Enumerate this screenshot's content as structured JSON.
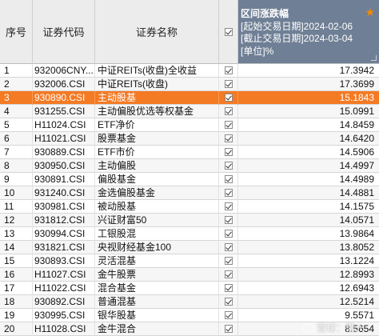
{
  "header": {
    "idx": "序号",
    "code": "证券代码",
    "name": "证券名称",
    "pct_title": "区间涨跌幅",
    "pct_start": "[起始交易日期]2024-02-06",
    "pct_end": "[截止交易日期]2024-03-04",
    "pct_unit": "[单位]%"
  },
  "rows": [
    {
      "idx": "1",
      "code": "932006CNY...",
      "name": "中证REITs(收盘)全收益",
      "pct": "17.3942"
    },
    {
      "idx": "2",
      "code": "932006.CSI",
      "name": "中证REITs(收盘)",
      "pct": "17.3699"
    },
    {
      "idx": "3",
      "code": "930890.CSI",
      "name": "主动股基",
      "pct": "15.1843"
    },
    {
      "idx": "4",
      "code": "931255.CSI",
      "name": "主动偏股优选等权基金",
      "pct": "15.0991"
    },
    {
      "idx": "5",
      "code": "H11024.CSI",
      "name": "ETF净价",
      "pct": "14.8459"
    },
    {
      "idx": "6",
      "code": "H11021.CSI",
      "name": "股票基金",
      "pct": "14.6420"
    },
    {
      "idx": "7",
      "code": "930889.CSI",
      "name": "ETF市价",
      "pct": "14.5906"
    },
    {
      "idx": "8",
      "code": "930950.CSI",
      "name": "主动偏股",
      "pct": "14.4997"
    },
    {
      "idx": "9",
      "code": "930891.CSI",
      "name": "偏股基金",
      "pct": "14.4989"
    },
    {
      "idx": "10",
      "code": "931240.CSI",
      "name": "金选偏股基金",
      "pct": "14.4881"
    },
    {
      "idx": "11",
      "code": "930981.CSI",
      "name": "被动股基",
      "pct": "14.1575"
    },
    {
      "idx": "12",
      "code": "931812.CSI",
      "name": "兴证财富50",
      "pct": "14.0571"
    },
    {
      "idx": "13",
      "code": "930994.CSI",
      "name": "工银股混",
      "pct": "13.9864"
    },
    {
      "idx": "14",
      "code": "931821.CSI",
      "name": "央视财经基金100",
      "pct": "13.8052"
    },
    {
      "idx": "15",
      "code": "930893.CSI",
      "name": "灵活混基",
      "pct": "13.1224"
    },
    {
      "idx": "16",
      "code": "H11027.CSI",
      "name": "金牛股票",
      "pct": "12.8993"
    },
    {
      "idx": "17",
      "code": "H11022.CSI",
      "name": "混合基金",
      "pct": "12.6943"
    },
    {
      "idx": "18",
      "code": "930892.CSI",
      "name": "普通混基",
      "pct": "12.5214"
    },
    {
      "idx": "19",
      "code": "930995.CSI",
      "name": "银华股基",
      "pct": "9.5571"
    },
    {
      "idx": "20",
      "code": "H11028.CSI",
      "name": "金牛混合",
      "pct": "8.5654"
    }
  ],
  "selected_row": "3",
  "watermark": "雪球：懒人...",
  "icons": {
    "header_star": "star-icon",
    "checkbox": "checkbox-checked-icon"
  },
  "colors": {
    "header_bg": "#ececec",
    "pct_header_bg": "#6f7f95",
    "selected_row": "#f47a24",
    "star": "#f08a00"
  }
}
